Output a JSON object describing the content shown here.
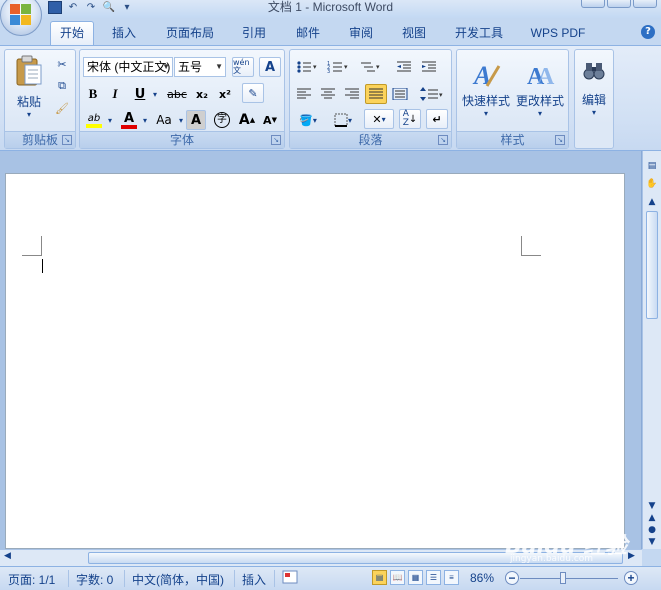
{
  "window": {
    "title": "文档 1 - Microsoft Word"
  },
  "tabs": [
    {
      "label": "开始",
      "active": true
    },
    {
      "label": "插入"
    },
    {
      "label": "页面布局"
    },
    {
      "label": "引用"
    },
    {
      "label": "邮件"
    },
    {
      "label": "审阅"
    },
    {
      "label": "视图"
    },
    {
      "label": "开发工具"
    },
    {
      "label": "WPS PDF"
    }
  ],
  "clipboard": {
    "paste_label": "粘贴",
    "group_label": "剪贴板"
  },
  "font": {
    "font_name": "宋体 (中文正文)",
    "font_size": "五号",
    "group_label": "字体",
    "bold": "B",
    "italic": "I",
    "underline": "U",
    "strikethrough": "abc",
    "subscript": "x₂",
    "superscript": "x²",
    "font_case": "Aa",
    "grow": "A",
    "shrink": "A",
    "phonetic": "wén 文",
    "char_border": "A",
    "char_shading": "A",
    "enclose": "字"
  },
  "paragraph": {
    "group_label": "段落"
  },
  "styles": {
    "quick_styles_label": "快速样式",
    "change_styles_label": "更改样式",
    "group_label": "样式"
  },
  "editing": {
    "label": "编辑"
  },
  "status": {
    "page": "页面: 1/1",
    "words": "字数: 0",
    "language": "中文(简体，中国)",
    "mode": "插入",
    "zoom": "86%"
  },
  "colors": {
    "highlight": "#ffff00",
    "font_color": "#e00000",
    "accent": "#15428b"
  },
  "watermark": {
    "text": "Baidu 经验",
    "sub": "jingyan.baidu.com"
  }
}
